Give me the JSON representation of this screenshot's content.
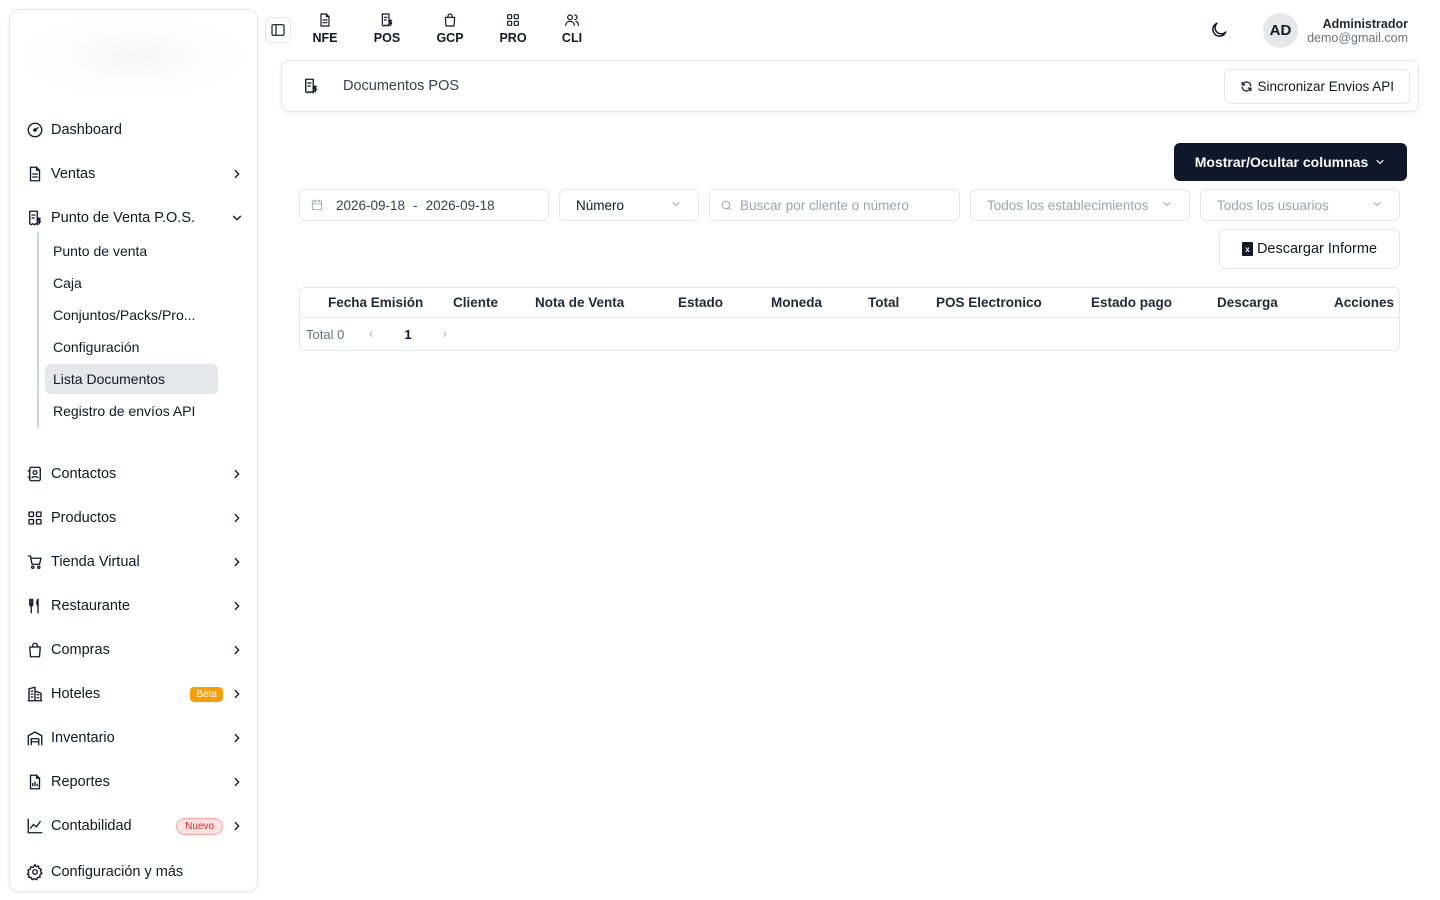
{
  "sidebar": {
    "items": [
      {
        "label": "Dashboard",
        "icon": "dashboard-gauge-icon",
        "chevron": false
      },
      {
        "label": "Ventas",
        "icon": "document-icon",
        "chevron": "right"
      },
      {
        "label": "Punto de Venta P.O.S.",
        "icon": "receipt-dollar-icon",
        "chevron": "down"
      },
      {
        "label": "Contactos",
        "icon": "contacts-book-icon",
        "chevron": "right"
      },
      {
        "label": "Productos",
        "icon": "grid-icon",
        "chevron": "right"
      },
      {
        "label": "Tienda Virtual",
        "icon": "cart-icon",
        "chevron": "right"
      },
      {
        "label": "Restaurante",
        "icon": "utensils-icon",
        "chevron": "right"
      },
      {
        "label": "Compras",
        "icon": "shopping-bag-icon",
        "chevron": "right"
      },
      {
        "label": "Hoteles",
        "icon": "building-icon",
        "chevron": "right",
        "badge": "Beta"
      },
      {
        "label": "Inventario",
        "icon": "warehouse-icon",
        "chevron": "right"
      },
      {
        "label": "Reportes",
        "icon": "report-chart-icon",
        "chevron": "right"
      },
      {
        "label": "Contabilidad",
        "icon": "line-chart-icon",
        "chevron": "right",
        "badge": "Nuevo"
      },
      {
        "label": "Configuración y más",
        "icon": "gear-icon",
        "chevron": false
      }
    ],
    "submenu": [
      {
        "label": "Punto de venta",
        "active": false
      },
      {
        "label": "Caja",
        "active": false
      },
      {
        "label": "Conjuntos/Packs/Pro...",
        "active": false
      },
      {
        "label": "Configuración",
        "active": false
      },
      {
        "label": "Lista Documentos",
        "active": true
      },
      {
        "label": "Registro de envíos API",
        "active": false
      }
    ]
  },
  "topnav": [
    {
      "label": "NFE",
      "icon": "document-icon"
    },
    {
      "label": "POS",
      "icon": "receipt-dollar-icon"
    },
    {
      "label": "GCP",
      "icon": "shopping-bag-icon"
    },
    {
      "label": "PRO",
      "icon": "grid-icon"
    },
    {
      "label": "CLI",
      "icon": "users-icon"
    }
  ],
  "user": {
    "initials": "AD",
    "name": "Administrador",
    "email": "demo@gmail.com"
  },
  "header": {
    "title": "Documentos POS",
    "sync_label": "Sincronizar Envios API"
  },
  "columns_button": "Mostrar/Ocultar columnas",
  "filters": {
    "date_from": "2026-09-18",
    "date_sep": "-",
    "date_to": "2026-09-18",
    "search_type": "Número",
    "search_placeholder": "Buscar por cliente o número",
    "establishments_placeholder": "Todos los establecimientos",
    "users_placeholder": "Todos los usuarios"
  },
  "download_label": "Descargar Informe",
  "table": {
    "headers": [
      "Fecha Emisión",
      "Cliente",
      "Nota de Venta",
      "Estado",
      "Moneda",
      "Total",
      "POS Electronico",
      "Estado pago",
      "Descarga",
      "Acciones"
    ],
    "rows": []
  },
  "pagination": {
    "total_label": "Total 0",
    "current_page": "1"
  },
  "colors": {
    "accent_dark": "#0f172a",
    "beta_badge": "#f59e0b",
    "new_badge": "#dc2626",
    "active_bg": "#e5e7eb"
  }
}
